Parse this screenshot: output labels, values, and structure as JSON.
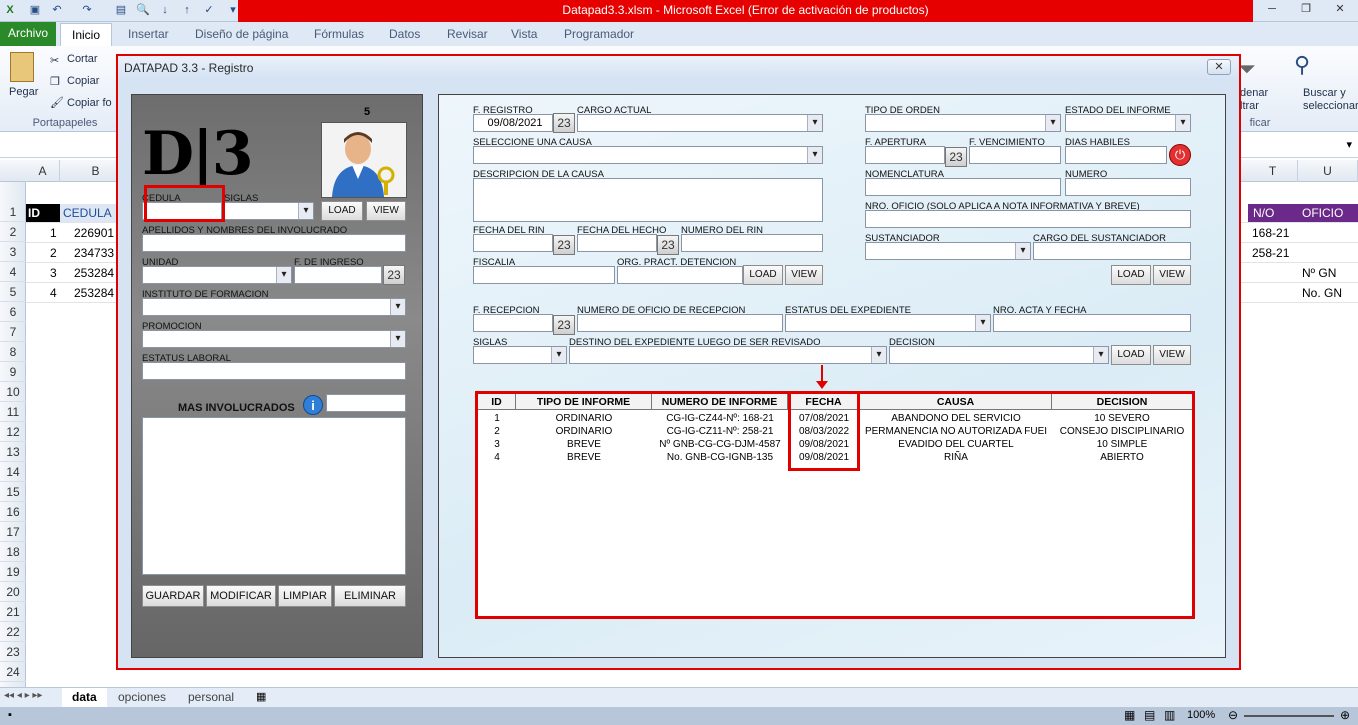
{
  "window": {
    "title": "Datapad3.3.xlsm  -  Microsoft Excel (Error de activación de productos)"
  },
  "ribbon": {
    "tabs": [
      "Archivo",
      "Inicio",
      "Insertar",
      "Diseño de página",
      "Fórmulas",
      "Datos",
      "Revisar",
      "Vista",
      "Programador"
    ],
    "paste": "Pegar",
    "cut": "Cortar",
    "copy": "Copiar",
    "format_painter": "Copiar fo",
    "clipboard_group": "Portapapeles",
    "sort_filter": "denar\nltrar",
    "find_select": "Buscar y\nseleccionar",
    "edit_group": "ficar"
  },
  "sheet": {
    "col_headers": [
      "A",
      "B",
      "T",
      "U"
    ],
    "row_numbers": [
      "1",
      "2",
      "3",
      "4",
      "5",
      "6",
      "7",
      "8",
      "9",
      "10",
      "11",
      "12",
      "13",
      "14",
      "15",
      "16",
      "17",
      "18",
      "19",
      "20",
      "21",
      "22",
      "23",
      "24"
    ],
    "row1": {
      "id": "ID",
      "cedula": "CEDULA",
      "no": "N/O",
      "oficio": "OFICIO"
    },
    "rows": [
      {
        "id": "1",
        "cedula": "226901",
        "no": "168-21",
        "oficio": ""
      },
      {
        "id": "2",
        "cedula": "234733",
        "no": "258-21",
        "oficio": ""
      },
      {
        "id": "3",
        "cedula": "253284",
        "no": "",
        "oficio": "Nº GN"
      },
      {
        "id": "4",
        "cedula": "253284",
        "no": "",
        "oficio": "No. GN"
      }
    ],
    "tabs": [
      "data",
      "opciones",
      "personal"
    ],
    "zoom": "100%"
  },
  "dialog": {
    "title": "DATAPAD 3.3 - Registro",
    "close": "✕",
    "left": {
      "counter": "5",
      "logo": "D|3",
      "cedula_label": "CEDULA",
      "siglas_label": "SIGLAS",
      "load": "LOAD",
      "view": "VIEW",
      "apellidos_label": "APELLIDOS Y NOMBRES DEL INVOLUCRADO",
      "unidad_label": "UNIDAD",
      "ingreso_label": "F. DE INGRESO",
      "instituto_label": "INSTITUTO DE FORMACION",
      "promocion_label": "PROMOCION",
      "estatus_label": "ESTATUS LABORAL",
      "mas_label": "MAS INVOLUCRADOS",
      "guardar": "GUARDAR",
      "modificar": "MODIFICAR",
      "limpiar": "LIMPIAR",
      "eliminar": "ELIMINAR"
    },
    "right": {
      "f_registro_label": "F. REGISTRO",
      "f_registro_value": "09/08/2021",
      "cargo_label": "CARGO ACTUAL",
      "tipo_orden_label": "TIPO DE ORDEN",
      "estado_label": "ESTADO DEL INFORME",
      "causa_label": "SELECCIONE UNA CAUSA",
      "f_apertura_label": "F. APERTURA",
      "f_vencimiento_label": "F. VENCIMIENTO",
      "dias_label": "DIAS HABILES",
      "desc_label": "DESCRIPCION DE LA CAUSA",
      "nomenclatura_label": "NOMENCLATURA",
      "numero_label": "NUMERO",
      "nro_oficio_label": "NRO. OFICIO (SOLO APLICA A NOTA INFORMATIVA Y BREVE)",
      "fecha_rin_label": "FECHA DEL RIN",
      "fecha_hecho_label": "FECHA DEL HECHO",
      "numero_rin_label": "NUMERO DEL RIN",
      "sustanciador_label": "SUSTANCIADOR",
      "cargo_sust_label": "CARGO DEL SUSTANCIADOR",
      "fiscalia_label": "FISCALIA",
      "org_label": "ORG. PRACT. DETENCION",
      "f_recepcion_label": "F. RECEPCION",
      "num_oficio_rec_label": "NUMERO DE OFICIO DE RECEPCION",
      "estatus_exp_label": "ESTATUS DEL EXPEDIENTE",
      "nro_acta_label": "NRO. ACTA Y FECHA",
      "siglas_label": "SIGLAS",
      "destino_label": "DESTINO DEL EXPEDIENTE LUEGO DE SER REVISADO",
      "decision_label": "DECISION",
      "load": "LOAD",
      "view": "VIEW",
      "cal": "23"
    },
    "table": {
      "headers": [
        "ID",
        "TIPO DE INFORME",
        "NUMERO DE INFORME",
        "FECHA",
        "CAUSA",
        "DECISION"
      ],
      "rows": [
        [
          "1",
          "ORDINARIO",
          "CG-IG-CZ44-Nº: 168-21",
          "07/08/2021",
          "ABANDONO DEL SERVICIO",
          "10 SEVERO"
        ],
        [
          "2",
          "ORDINARIO",
          "CG-IG-CZ11-Nº: 258-21",
          "08/03/2022",
          "PERMANENCIA NO AUTORIZADA FUEI",
          "CONSEJO DISCIPLINARIO"
        ],
        [
          "3",
          "BREVE",
          "Nº GNB-CG-CG-DJM-4587",
          "09/08/2021",
          "EVADIDO DEL CUARTEL",
          "10 SIMPLE"
        ],
        [
          "4",
          "BREVE",
          "No. GNB-CG-IGNB-135",
          "09/08/2021",
          "RIÑA",
          "ABIERTO"
        ]
      ]
    }
  }
}
